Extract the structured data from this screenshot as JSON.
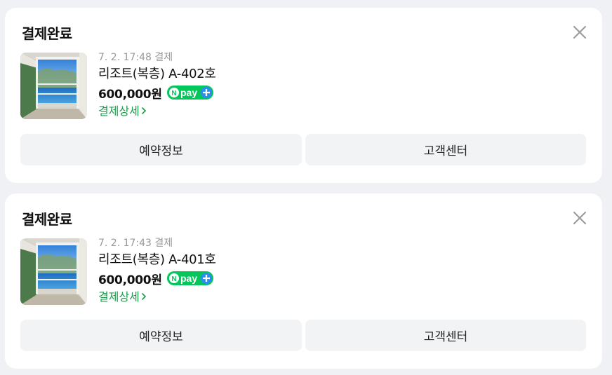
{
  "cards": [
    {
      "title": "결제완료",
      "date": "7. 2. 17:48 결제",
      "room": "리조트(복층) A-402호",
      "price": "600,000원",
      "pay_badge": "Npay+",
      "detail_link": "결제상세",
      "buttons": {
        "reservation": "예약정보",
        "support": "고객센터"
      },
      "icons": {
        "close": "close-icon",
        "thumbnail": "resort-balcony-photo",
        "chevron": "chevron-right-icon"
      }
    },
    {
      "title": "결제완료",
      "date": "7. 2. 17:43 결제",
      "room": "리조트(복층) A-401호",
      "price": "600,000원",
      "pay_badge": "Npay+",
      "detail_link": "결제상세",
      "buttons": {
        "reservation": "예약정보",
        "support": "고객센터"
      },
      "icons": {
        "close": "close-icon",
        "thumbnail": "resort-balcony-photo",
        "chevron": "chevron-right-icon"
      }
    }
  ],
  "colors": {
    "background": "#f0f1f4",
    "card": "#ffffff",
    "link_green": "#1b9e4b",
    "npay_green": "#03c75a",
    "npay_plus_blue": "#2d8cf0",
    "button_bg": "#f2f3f5"
  }
}
